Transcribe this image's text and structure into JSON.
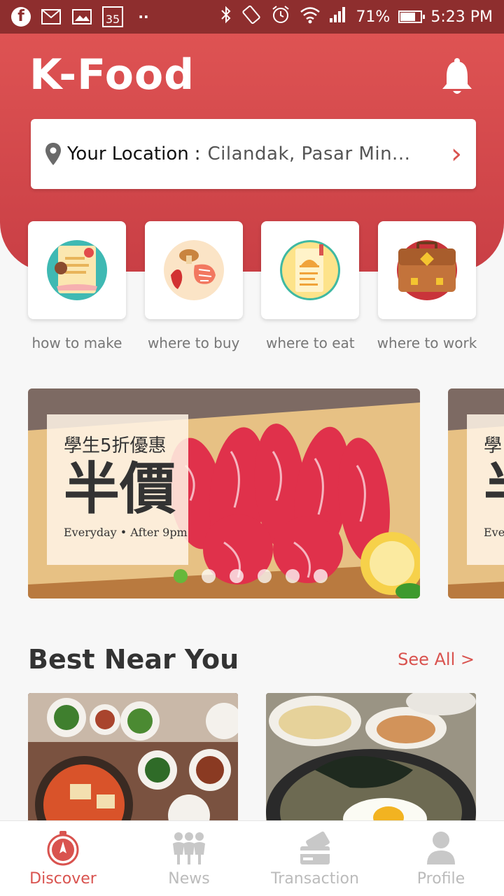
{
  "status_bar": {
    "calendar_day": "35",
    "dots": "··",
    "battery_percent": "71%",
    "time": "5:23 PM",
    "icons": [
      "facebook-icon",
      "gmail-icon",
      "gallery-icon",
      "calendar-icon",
      "bluetooth-icon",
      "rotate-icon",
      "alarm-icon",
      "wifi-icon",
      "signal-icon",
      "battery-icon"
    ]
  },
  "header": {
    "title": "K-Food",
    "bell_icon": "bell-icon"
  },
  "location": {
    "label": "Your Location",
    "separator": ":",
    "value": "Cilandak, Pasar Min...",
    "icon": "location-pin-icon",
    "chevron": "›"
  },
  "categories": [
    {
      "label": "how to make",
      "icon": "recipe-icon"
    },
    {
      "label": "where to buy",
      "icon": "ingredients-icon"
    },
    {
      "label": "where to eat",
      "icon": "menu-icon"
    },
    {
      "label": "where to work",
      "icon": "briefcase-icon"
    }
  ],
  "banner": {
    "line1": "學生5折優惠",
    "big": "半價",
    "small": "Everyday • After 9pm",
    "next_line1": "學",
    "next_big": "半",
    "next_small": "Ever",
    "dot_count": 6,
    "active_dot": 0
  },
  "best_near_you": {
    "title": "Best Near You",
    "see_all": "See All >"
  },
  "bottom_nav": [
    {
      "label": "Discover",
      "icon": "compass-icon",
      "active": true
    },
    {
      "label": "News",
      "icon": "people-icon",
      "active": false
    },
    {
      "label": "Transaction",
      "icon": "payment-icon",
      "active": false
    },
    {
      "label": "Profile",
      "icon": "person-icon",
      "active": false
    }
  ],
  "colors": {
    "primary": "#d9534f",
    "status_bar": "#8e2e2e",
    "active_dot": "#66b83b"
  }
}
